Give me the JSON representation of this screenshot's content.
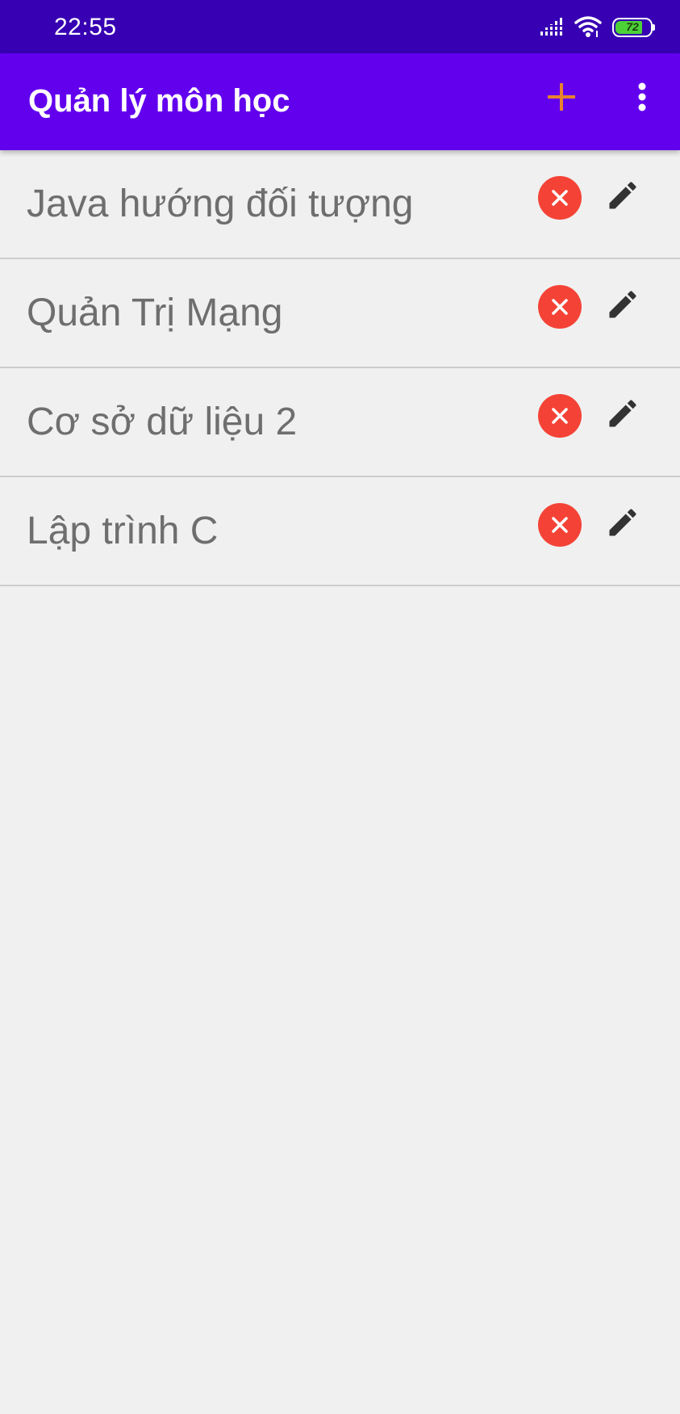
{
  "status_bar": {
    "time": "22:55",
    "battery_level": "72",
    "icons": [
      "signal-icon",
      "wifi-icon",
      "battery-icon"
    ]
  },
  "app_bar": {
    "title": "Quản lý môn học",
    "actions": [
      "add-icon",
      "more-vert-icon"
    ],
    "add_icon_color": "#e8822e",
    "background_color": "#6200ee"
  },
  "subjects": [
    {
      "name": "Java hướng đối tượng"
    },
    {
      "name": "Quản Trị Mạng"
    },
    {
      "name": "Cơ sở dữ liệu 2"
    },
    {
      "name": "Lập trình C"
    }
  ],
  "item_actions": {
    "delete_icon": "close-circle-icon",
    "delete_color": "#f44336",
    "edit_icon": "pencil-icon"
  }
}
